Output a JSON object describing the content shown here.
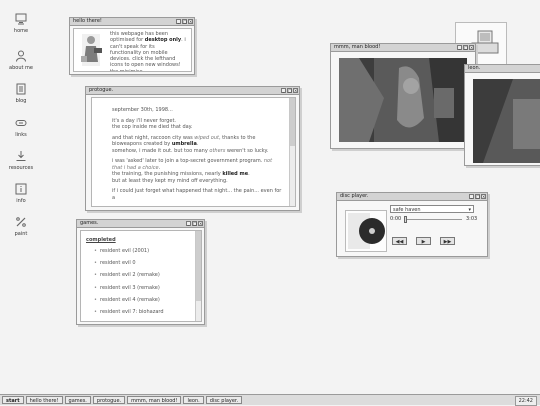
{
  "desktop_icons": [
    {
      "label": "home",
      "icon": "monitor-icon"
    },
    {
      "label": "about me",
      "icon": "person-icon"
    },
    {
      "label": "blog",
      "icon": "notebook-icon"
    },
    {
      "label": "links",
      "icon": "link-icon"
    },
    {
      "label": "resources",
      "icon": "download-icon"
    },
    {
      "label": "info",
      "icon": "info-icon"
    },
    {
      "label": "paint",
      "icon": "paint-icon"
    }
  ],
  "hello_window": {
    "title": "hello there!",
    "text_1": "this webpage has been optimised for ",
    "text_bold": "desktop only",
    "text_2": ". i can't speak for its functionality on mobile devices. click the lefthand icons to open new windows! the minimise"
  },
  "prologue_window": {
    "title": "protogue.",
    "date": "september 30th, 1998...",
    "p2a": "it's a day i'll never forget.",
    "p2b": "the cop inside me died that day.",
    "p3a_1": "and that night, raccoon city was ",
    "p3a_i": "wiped out",
    "p3a_2": ", thanks to the bioweapons created by ",
    "p3a_b": "umbrella",
    "p3a_3": ".",
    "p3b_1": "somehow, i made it out. but too many ",
    "p3b_i": "others",
    "p3b_2": " weren't so lucky.",
    "p4a_1": "i was 'asked' later to join a top-secret government program. ",
    "p4a_i": "not that i had a choice",
    "p4a_2": ".",
    "p4b_1": "the training, the punishing missions, nearly ",
    "p4b_b": "killed me",
    "p4b_2": ".",
    "p4c": "but at least they kept my mind off everything.",
    "p5": "if i could just forget what happened that night... the pain... even for a"
  },
  "games_window": {
    "title": "games.",
    "heading": "completed",
    "items": [
      "resident evil (2001)",
      "resident evil 0",
      "resident evil 2 (remake)",
      "resident evil 3 (remake)",
      "resident evil 4 (remake)",
      "resident evil 7: biohazard"
    ]
  },
  "video_window": {
    "title": "mmm, man blood!"
  },
  "second_video_window": {
    "title": "leon."
  },
  "player_window": {
    "title": "disc player.",
    "track": "safe haven",
    "time_current": "0:00",
    "time_total": "3:03",
    "progress": 0,
    "prev": "◀◀",
    "play": "▶",
    "next": "▶▶"
  },
  "taskbar": {
    "start": "start",
    "items": [
      "hello there!",
      "games.",
      "protogue.",
      "mmm, man blood!",
      "leon.",
      "disc player."
    ],
    "clock": "22:42"
  },
  "colors": {
    "background": "#f3f3f3",
    "titlebar": "#d3d3d3",
    "border": "#9a9a9a"
  }
}
